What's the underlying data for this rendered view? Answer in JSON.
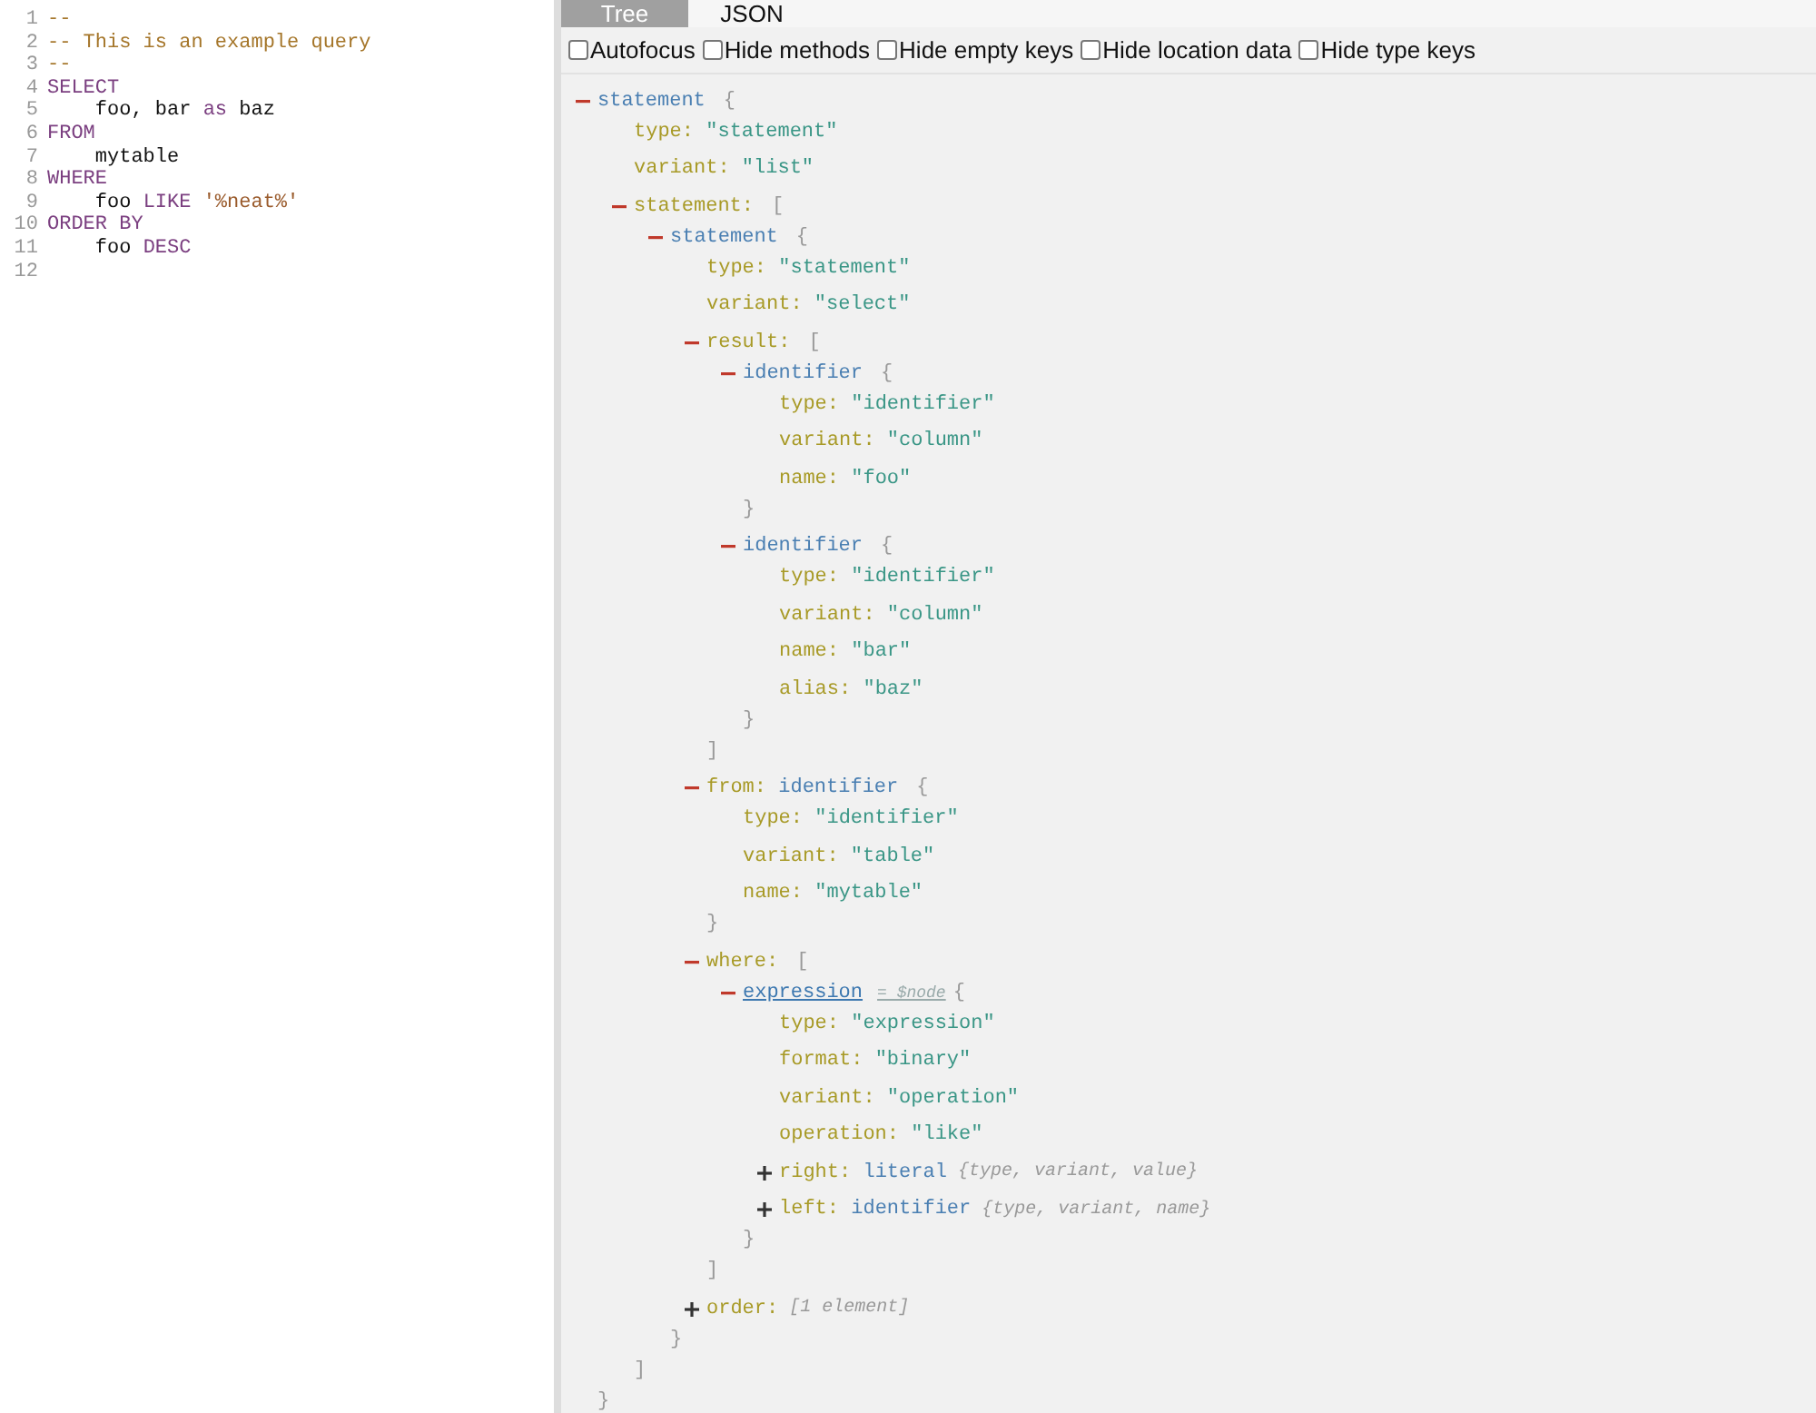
{
  "editor": {
    "lines": [
      {
        "number": "1",
        "tokens": [
          {
            "kind": "comment",
            "text": "--"
          }
        ]
      },
      {
        "number": "2",
        "tokens": [
          {
            "kind": "comment",
            "text": "-- This is an example query"
          }
        ]
      },
      {
        "number": "3",
        "tokens": [
          {
            "kind": "comment",
            "text": "--"
          }
        ]
      },
      {
        "number": "4",
        "tokens": [
          {
            "kind": "keyword",
            "text": "SELECT"
          }
        ]
      },
      {
        "number": "5",
        "tokens": [
          {
            "kind": "plain",
            "text": "    foo, bar "
          },
          {
            "kind": "keyword",
            "text": "as"
          },
          {
            "kind": "plain",
            "text": " baz"
          }
        ]
      },
      {
        "number": "6",
        "tokens": [
          {
            "kind": "keyword",
            "text": "FROM"
          }
        ]
      },
      {
        "number": "7",
        "tokens": [
          {
            "kind": "plain",
            "text": "    mytable"
          }
        ]
      },
      {
        "number": "8",
        "tokens": [
          {
            "kind": "keyword",
            "text": "WHERE"
          }
        ]
      },
      {
        "number": "9",
        "tokens": [
          {
            "kind": "plain",
            "text": "    foo "
          },
          {
            "kind": "keyword",
            "text": "LIKE"
          },
          {
            "kind": "string",
            "text": " '%neat%'"
          }
        ]
      },
      {
        "number": "10",
        "tokens": [
          {
            "kind": "keyword",
            "text": "ORDER BY"
          }
        ]
      },
      {
        "number": "11",
        "tokens": [
          {
            "kind": "plain",
            "text": "    foo "
          },
          {
            "kind": "keyword",
            "text": "DESC"
          }
        ]
      },
      {
        "number": "12"
      }
    ]
  },
  "tabs": [
    {
      "label": "Tree",
      "selected": true
    },
    {
      "label": "JSON",
      "selected": false
    }
  ],
  "options": [
    {
      "label": "Autofocus",
      "checked": false
    },
    {
      "label": "Hide methods",
      "checked": false
    },
    {
      "label": "Hide empty keys",
      "checked": false
    },
    {
      "label": "Hide location data",
      "checked": false
    },
    {
      "label": "Hide type keys",
      "checked": false
    }
  ],
  "tree": {
    "kind": "object",
    "type": "statement",
    "expanded": true,
    "highlighted": false,
    "open": "{",
    "close": "}",
    "children": [
      {
        "kind": "prop",
        "key": "type:",
        "value": "\"statement\""
      },
      {
        "kind": "prop",
        "key": "variant:",
        "value": "\"list\""
      },
      {
        "kind": "array",
        "key": "statement:",
        "expanded": true,
        "open": "[",
        "close": "]",
        "children": [
          {
            "kind": "object",
            "type": "statement",
            "expanded": true,
            "highlighted": false,
            "open": "{",
            "close": "}",
            "children": [
              {
                "kind": "prop",
                "key": "type:",
                "value": "\"statement\""
              },
              {
                "kind": "prop",
                "key": "variant:",
                "value": "\"select\""
              },
              {
                "kind": "array",
                "key": "result:",
                "expanded": true,
                "open": "[",
                "close": "]",
                "children": [
                  {
                    "kind": "object",
                    "type": "identifier",
                    "expanded": true,
                    "highlighted": false,
                    "open": "{",
                    "close": "}",
                    "children": [
                      {
                        "kind": "prop",
                        "key": "type:",
                        "value": "\"identifier\""
                      },
                      {
                        "kind": "prop",
                        "key": "variant:",
                        "value": "\"column\""
                      },
                      {
                        "kind": "prop",
                        "key": "name:",
                        "value": "\"foo\""
                      }
                    ]
                  },
                  {
                    "kind": "object",
                    "type": "identifier",
                    "expanded": true,
                    "highlighted": false,
                    "open": "{",
                    "close": "}",
                    "children": [
                      {
                        "kind": "prop",
                        "key": "type:",
                        "value": "\"identifier\""
                      },
                      {
                        "kind": "prop",
                        "key": "variant:",
                        "value": "\"column\""
                      },
                      {
                        "kind": "prop",
                        "key": "name:",
                        "value": "\"bar\""
                      },
                      {
                        "kind": "prop",
                        "key": "alias:",
                        "value": "\"baz\""
                      }
                    ]
                  }
                ]
              },
              {
                "kind": "object",
                "key": "from:",
                "type": "identifier",
                "expanded": true,
                "highlighted": false,
                "open": "{",
                "close": "}",
                "children": [
                  {
                    "kind": "prop",
                    "key": "type:",
                    "value": "\"identifier\""
                  },
                  {
                    "kind": "prop",
                    "key": "variant:",
                    "value": "\"table\""
                  },
                  {
                    "kind": "prop",
                    "key": "name:",
                    "value": "\"mytable\""
                  }
                ]
              },
              {
                "kind": "array",
                "key": "where:",
                "expanded": true,
                "open": "[",
                "close": "]",
                "children": [
                  {
                    "kind": "object",
                    "type": "expression",
                    "annotation": "= $node",
                    "expanded": true,
                    "highlighted": true,
                    "open": "{",
                    "close": "}",
                    "children": [
                      {
                        "kind": "prop",
                        "key": "type:",
                        "value": "\"expression\""
                      },
                      {
                        "kind": "prop",
                        "key": "format:",
                        "value": "\"binary\""
                      },
                      {
                        "kind": "prop",
                        "key": "variant:",
                        "value": "\"operation\""
                      },
                      {
                        "kind": "prop",
                        "key": "operation:",
                        "value": "\"like\""
                      },
                      {
                        "kind": "object",
                        "key": "right:",
                        "type": "literal",
                        "expanded": false,
                        "highlighted": false,
                        "summary": "{type, variant, value}"
                      },
                      {
                        "kind": "object",
                        "key": "left:",
                        "type": "identifier",
                        "expanded": false,
                        "highlighted": false,
                        "summary": "{type, variant, name}"
                      }
                    ]
                  }
                ]
              },
              {
                "kind": "array",
                "key": "order:",
                "expanded": false,
                "summary": "[1 element]"
              }
            ]
          }
        ]
      }
    ]
  }
}
